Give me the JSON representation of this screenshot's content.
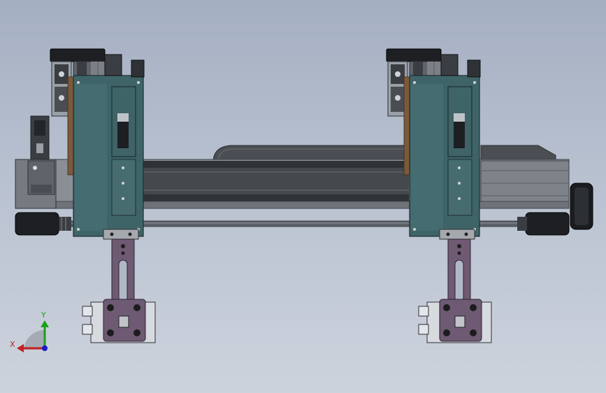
{
  "view": {
    "background_top": "#a4afc2",
    "background_bottom": "#cdd3dd"
  },
  "colors": {
    "plate_teal": "#3f6468",
    "arm_purple": "#6e5a72",
    "rail_dark": "#3a3d42",
    "profile_gray": "#8a8f96",
    "motor_black": "#1d1f22",
    "belt_brown": "#7b5a3c"
  },
  "triad": {
    "x_label": "X",
    "y_label": "Y",
    "x_color": "#c42020",
    "y_color": "#1aa01a",
    "z_color": "#1a1ac8"
  }
}
